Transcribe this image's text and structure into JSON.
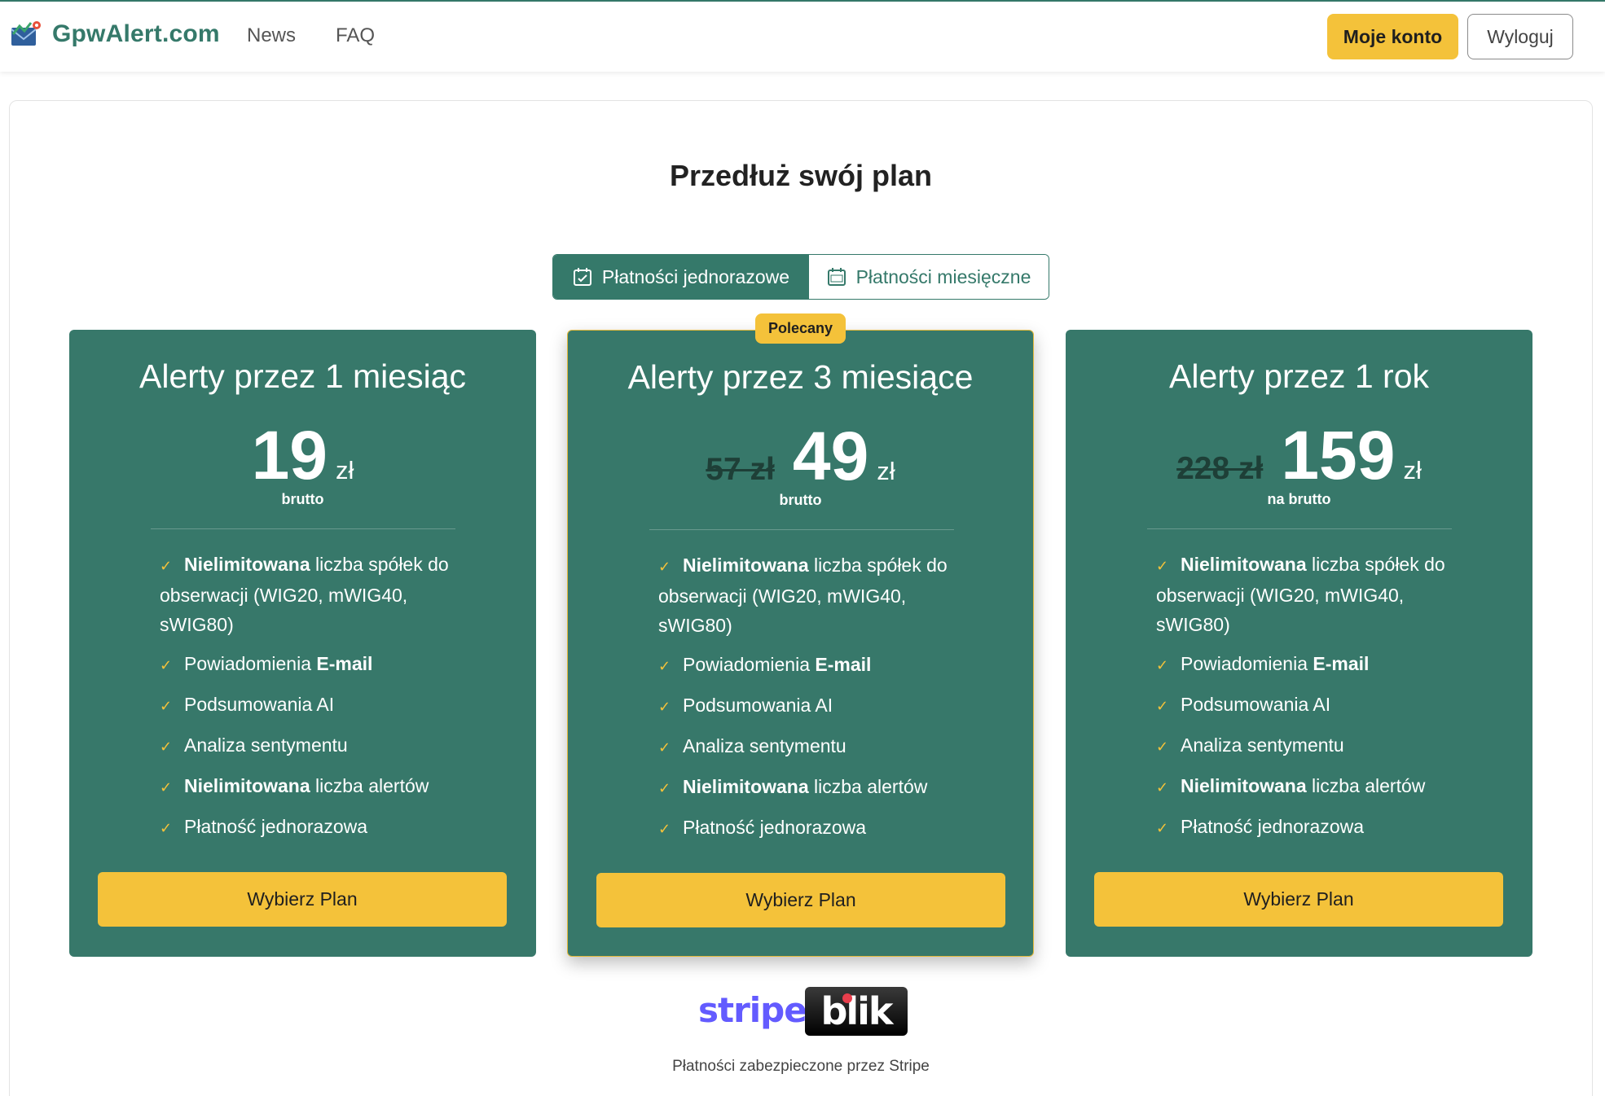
{
  "navbar": {
    "brand": "GpwAlert.com",
    "links": [
      "News",
      "FAQ"
    ],
    "account_button": "Moje konto",
    "logout_button": "Wyloguj"
  },
  "page": {
    "title": "Przedłuż swój plan"
  },
  "billing_toggle": {
    "options": [
      {
        "label": "Płatności jednorazowe",
        "icon": "calendar-check-icon",
        "active": true
      },
      {
        "label": "Płatności miesięczne",
        "icon": "calendar-month-icon",
        "active": false
      }
    ]
  },
  "plans": [
    {
      "title": "Alerty przez 1 miesiąc",
      "old_price": "",
      "price": "19",
      "currency": "zł",
      "price_note": "brutto",
      "features": [
        {
          "bold": "Nielimitowana",
          "text": " liczba spółek do obserwacji (WIG20, mWIG40, sWIG80)"
        },
        {
          "pre": "Powiadomienia ",
          "bold": "E-mail",
          "text": ""
        },
        {
          "text": "Podsumowania AI"
        },
        {
          "text": "Analiza sentymentu"
        },
        {
          "bold": "Nielimitowana",
          "text": " liczba alertów"
        },
        {
          "text": "Płatność jednorazowa"
        }
      ],
      "button": "Wybierz Plan"
    },
    {
      "badge": "Polecany",
      "title": "Alerty przez 3 miesiące",
      "old_price": "57 zł",
      "price": "49",
      "currency": "zł",
      "price_note": "brutto",
      "features": [
        {
          "bold": "Nielimitowana",
          "text": " liczba spółek do obserwacji (WIG20, mWIG40, sWIG80)"
        },
        {
          "pre": "Powiadomienia ",
          "bold": "E-mail",
          "text": ""
        },
        {
          "text": "Podsumowania AI"
        },
        {
          "text": "Analiza sentymentu"
        },
        {
          "bold": "Nielimitowana",
          "text": " liczba alertów"
        },
        {
          "text": "Płatność jednorazowa"
        }
      ],
      "button": "Wybierz Plan"
    },
    {
      "title": "Alerty przez 1 rok",
      "old_price": "228 zł",
      "price": "159",
      "currency": "zł",
      "price_note": "na brutto",
      "features": [
        {
          "bold": "Nielimitowana",
          "text": " liczba spółek do obserwacji (WIG20, mWIG40, sWIG80)"
        },
        {
          "pre": "Powiadomienia ",
          "bold": "E-mail",
          "text": ""
        },
        {
          "text": "Podsumowania AI"
        },
        {
          "text": "Analiza sentymentu"
        },
        {
          "bold": "Nielimitowana",
          "text": " liczba alertów"
        },
        {
          "text": "Płatność jednorazowa"
        }
      ],
      "button": "Wybierz Plan"
    }
  ],
  "payment": {
    "stripe_logo": "stripe",
    "blik_logo": "blik",
    "secure_text": "Płatności zabezpieczone przez Stripe"
  },
  "colors": {
    "brand_green": "#35796a",
    "accent_yellow": "#f4c23a",
    "stripe_purple": "#635bff",
    "blik_red": "#e83e4c"
  }
}
